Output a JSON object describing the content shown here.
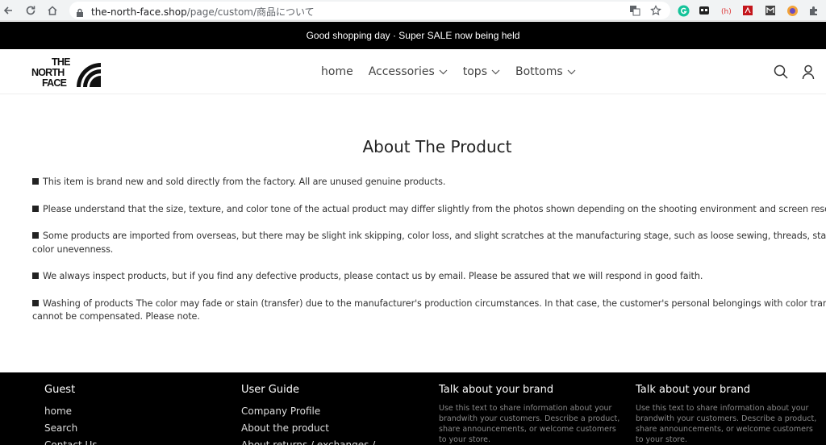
{
  "browser": {
    "url_host": "the-north-face.shop",
    "url_path": "/page/custom/商品について"
  },
  "announcement": "Good shopping day · Super SALE now being held",
  "header": {
    "logo_text": [
      "THE",
      "NORTH",
      "FACE"
    ],
    "nav": [
      {
        "label": "home",
        "dropdown": false
      },
      {
        "label": "Accessories",
        "dropdown": true
      },
      {
        "label": "tops",
        "dropdown": true
      },
      {
        "label": "Bottoms",
        "dropdown": true
      }
    ]
  },
  "main": {
    "title": "About The Product",
    "paragraphs": [
      [
        "This item is brand new and sold directly from the factory. All are unused genuine products."
      ],
      [
        "Please understand that the size, texture, and color tone of the actual product may differ slightly from the photos shown depending on the shooting environment and screen resoluti"
      ],
      [
        "Some products are imported from overseas, but there may be slight ink skipping, color loss, and slight scratches at the manufacturing stage, such as loose sewing, threads, stains, ar",
        "color unevenness."
      ],
      [
        "We always inspect products, but if you find any defective products, please contact us by email. Please be assured that we will respond in good faith."
      ],
      [
        "Washing of products The color may fade or stain (transfer) due to the manufacturer's production circumstances. In that case, the customer's personal belongings with color transfer",
        "cannot be compensated. Please note."
      ]
    ]
  },
  "footer": {
    "guest": {
      "title": "Guest",
      "links": [
        "home",
        "Search",
        "Contact Us"
      ]
    },
    "guide": {
      "title": "User Guide",
      "links": [
        "Company Profile",
        "About the product",
        "About returns / exchanges /"
      ]
    },
    "brand1": {
      "title": "Talk about your brand",
      "text": "Use this text to share information about your brandwith your customers. Describe a product, share announcements, or welcome customers to your store."
    },
    "brand2": {
      "title": "Talk about your brand",
      "text": "Use this text to share information about your brandwith your customers. Describe a product, share announcements, or welcome customers to your store."
    }
  }
}
